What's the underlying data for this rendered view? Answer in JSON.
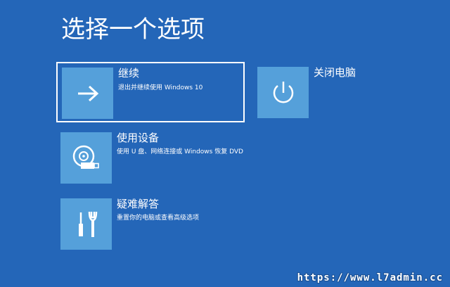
{
  "page": {
    "title": "选择一个选项"
  },
  "options": {
    "continue": {
      "label": "继续",
      "description": "退出并继续使用 Windows 10",
      "icon": "arrow-right-icon"
    },
    "use_device": {
      "label": "使用设备",
      "description": "使用 U 盘、网络连接或 Windows 恢复 DVD",
      "icon": "disc-usb-icon"
    },
    "troubleshoot": {
      "label": "疑难解答",
      "description": "重置你的电脑或查看高级选项",
      "icon": "tools-icon"
    },
    "shutdown": {
      "label": "关闭电脑",
      "icon": "power-icon"
    }
  },
  "watermark": "https://www.l7admin.cc",
  "colors": {
    "background": "#2466b8",
    "tile": "#55a0da",
    "text": "#ffffff"
  }
}
